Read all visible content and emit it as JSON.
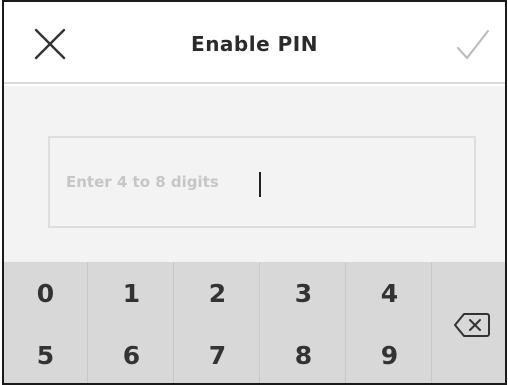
{
  "header": {
    "title": "Enable PIN",
    "close_icon": "close-icon",
    "confirm_icon": "checkmark-icon"
  },
  "pin_field": {
    "value": "",
    "placeholder": "Enter 4 to 8 digits"
  },
  "keypad": {
    "row1": [
      "0",
      "1",
      "2",
      "3",
      "4"
    ],
    "row2": [
      "5",
      "6",
      "7",
      "8",
      "9"
    ],
    "backspace_icon": "backspace-icon"
  },
  "colors": {
    "keypad_bg": "#d8d8d8",
    "field_bg": "#f3f3f3",
    "placeholder": "#c6c6c6",
    "checkmark_disabled": "#bdbdbd"
  }
}
